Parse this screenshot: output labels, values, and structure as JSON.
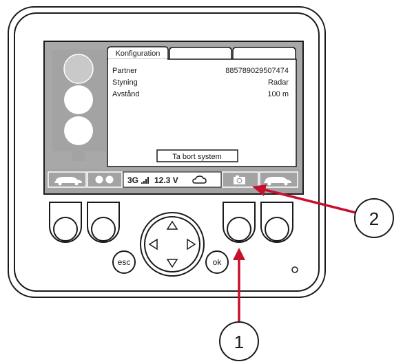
{
  "screen": {
    "tabs": [
      {
        "label": "Konfiguration"
      },
      {
        "label": ""
      },
      {
        "label": ""
      }
    ],
    "rows": [
      {
        "key": "Partner",
        "value": "885789029507474"
      },
      {
        "key": "Styning",
        "value": "Radar"
      },
      {
        "key": "Avstånd",
        "value": "100 m"
      }
    ],
    "remove_button_label": "Ta bort system",
    "status_bar": {
      "network": "3G",
      "voltage": "12.3 V"
    }
  },
  "device": {
    "esc_label": "esc",
    "ok_label": "ok"
  },
  "callouts": [
    {
      "number": "1"
    },
    {
      "number": "2"
    }
  ],
  "colors": {
    "callout_arrow": "#c8102e",
    "screen_frame": "#a3a3a3",
    "bezel": "#1a1a1a"
  }
}
